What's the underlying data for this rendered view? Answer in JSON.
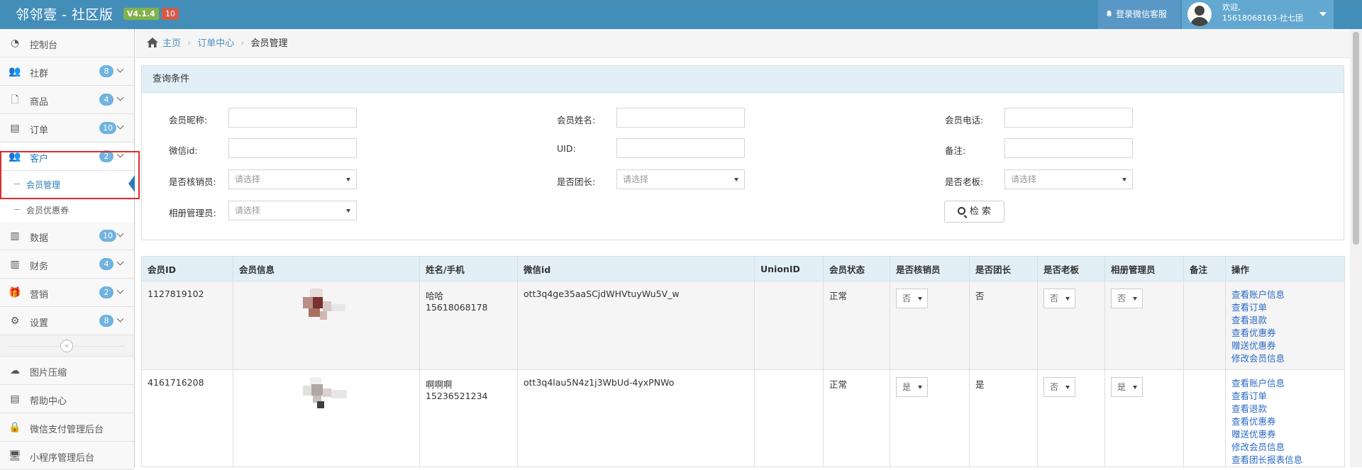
{
  "app": {
    "title": "邻邻壹 - 社区版",
    "version": "V4.1.4",
    "version_count": "10"
  },
  "header": {
    "kefu_label": "登录微信客服",
    "welcome": "欢迎,",
    "user": "15618068163-社七团"
  },
  "sidebar": {
    "items": [
      {
        "label": "控制台",
        "icon": "dashboard-icon"
      },
      {
        "label": "社群",
        "badge": "8",
        "icon": "users-icon"
      },
      {
        "label": "商品",
        "badge": "4",
        "icon": "file-icon"
      },
      {
        "label": "订单",
        "badge": "10",
        "icon": "book-icon"
      },
      {
        "label": "客户",
        "badge": "2",
        "icon": "users-icon"
      },
      {
        "label": "数据",
        "badge": "10",
        "icon": "bar-chart-icon"
      },
      {
        "label": "财务",
        "badge": "4",
        "icon": "bar-chart-icon"
      },
      {
        "label": "营销",
        "badge": "2",
        "icon": "gift-icon"
      },
      {
        "label": "设置",
        "badge": "8",
        "icon": "cogs-icon"
      },
      {
        "label": "图片压缩",
        "icon": "cloud-upload-icon"
      },
      {
        "label": "帮助中心",
        "icon": "book-icon"
      },
      {
        "label": "微信支付管理后台",
        "icon": "lock-icon"
      },
      {
        "label": "小程序管理后台",
        "icon": "desktop-icon"
      }
    ],
    "sub_items": [
      {
        "label": "会员管理",
        "selected": true
      },
      {
        "label": "会员优惠券",
        "selected": false
      }
    ]
  },
  "breadcrumb": {
    "home": "主页",
    "parent": "订单中心",
    "current": "会员管理"
  },
  "query": {
    "title": "查询条件",
    "labels": {
      "nickname": "会员昵称:",
      "name": "会员姓名:",
      "phone": "会员电话:",
      "wxid": "微信id:",
      "uid": "UID:",
      "remark": "备注:",
      "verifier": "是否核销员:",
      "leader": "是否团长:",
      "boss": "是否老板:",
      "album": "相册管理员:"
    },
    "select_placeholder": "请选择",
    "search_label": "检 索"
  },
  "table": {
    "headers": [
      "会员ID",
      "会员信息",
      "姓名/手机",
      "微信id",
      "UnionID",
      "会员状态",
      "是否核销员",
      "是否团长",
      "是否老板",
      "相册管理员",
      "备注",
      "操作"
    ],
    "rows": [
      {
        "id": "1127819102",
        "name": "哈哈",
        "phone": "15618068178",
        "wxid": "ott3q4ge35aaSCjdWHVtuyWu5V_w",
        "unionid": "",
        "status": "正常",
        "verifier": "否",
        "leader": "否",
        "boss": "否",
        "album": "否",
        "remark": "",
        "ops": [
          "查看账户信息",
          "查看订单",
          "查看退款",
          "查看优惠券",
          "赠送优惠券",
          "修改会员信息"
        ]
      },
      {
        "id": "4161716208",
        "name": "啊啊啊",
        "phone": "15236521234",
        "wxid": "ott3q4lau5N4z1j3WbUd-4yxPNWo",
        "unionid": "",
        "status": "正常",
        "verifier": "是",
        "leader": "是",
        "boss": "否",
        "album": "是",
        "remark": "",
        "ops": [
          "查看账户信息",
          "查看订单",
          "查看退款",
          "查看优惠券",
          "赠送优惠券",
          "修改会员信息",
          "查看团长报表信息"
        ]
      }
    ]
  },
  "colors": {
    "topbar": "#438eb9",
    "accent": "#2b7dbc",
    "badge": "#6fb3e0",
    "link": "#2a6ac5",
    "highlight": "#e02b2b"
  }
}
